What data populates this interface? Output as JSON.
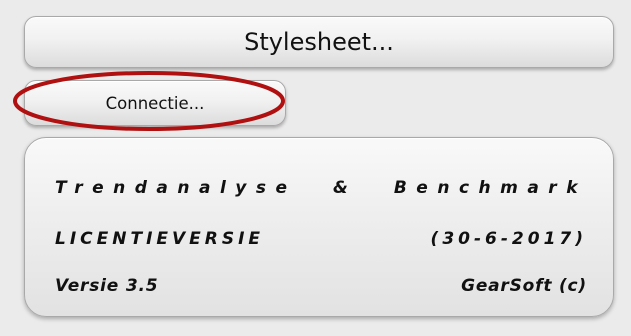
{
  "buttons": {
    "stylesheet_label": "Stylesheet...",
    "connectie_label": "Connectie..."
  },
  "info": {
    "title": "Trendanalyse & Benchmark",
    "license": "LICENTIEVERSIE",
    "date": "(30-6-2017)",
    "version": "Versie 3.5",
    "company": "GearSoft (c)"
  },
  "colors": {
    "highlight": "#b01010"
  }
}
